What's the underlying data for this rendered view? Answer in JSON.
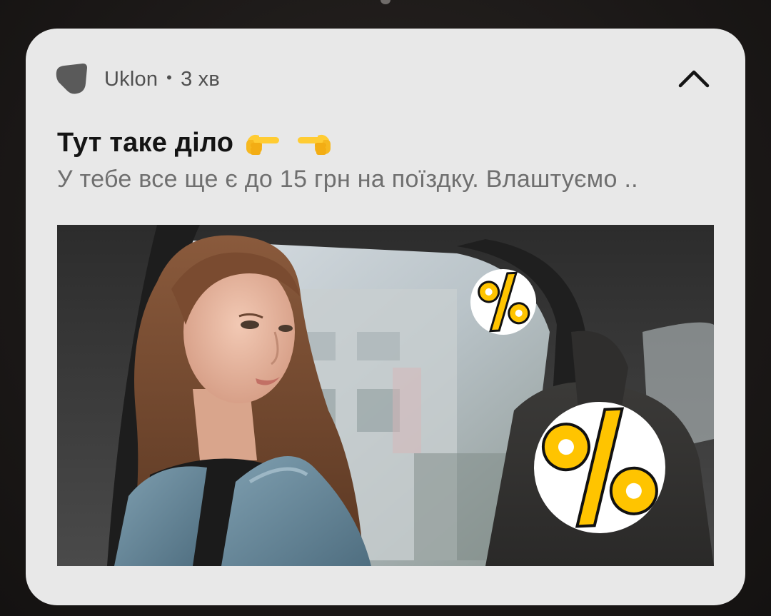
{
  "notification": {
    "app_name": "Uklon",
    "separator": "•",
    "time_ago": "3 хв",
    "title": "Тут таке діло",
    "body": "У тебе все ще є до 15 грн на поїздку. Влаштуємо ..",
    "emoji_icons": [
      "backhand-index-pointing-right-icon",
      "backhand-index-pointing-left-icon"
    ],
    "colors": {
      "card_bg": "#e8e8e8",
      "title": "#141414",
      "body": "#6f6f6f",
      "accent_yellow": "#ffc400"
    }
  },
  "image": {
    "description_icons": [
      "percent-sticker-icon",
      "percent-sticker-icon"
    ]
  }
}
